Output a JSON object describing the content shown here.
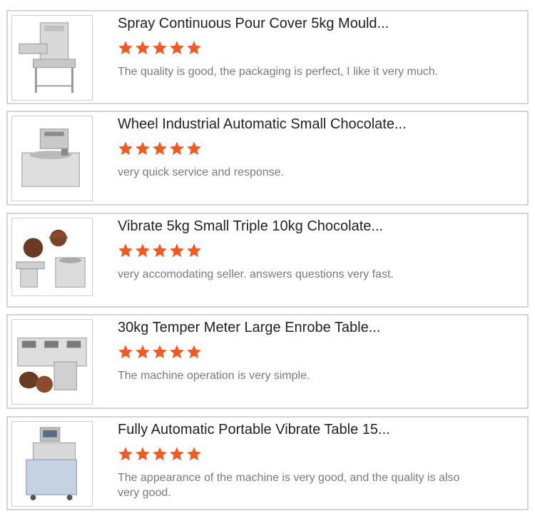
{
  "star_color": "#f15a22",
  "reviews": [
    {
      "title": "Spray Continuous Pour Cover 5kg Mould...",
      "rating": 5,
      "comment": "The quality is good, the packaging is perfect, I like it very much.",
      "image_icon": "chocolate-enrober-machine"
    },
    {
      "title": "Wheel Industrial Automatic Small Chocolate...",
      "rating": 5,
      "comment": "very quick service and response.",
      "image_icon": "chocolate-tempering-machine"
    },
    {
      "title": "Vibrate 5kg Small Triple 10kg Chocolate...",
      "rating": 5,
      "comment": "very accomodating seller. answers questions very fast.",
      "image_icon": "chocolate-melter-with-enrober"
    },
    {
      "title": "30kg Temper Meter Large Enrobe Table...",
      "rating": 5,
      "comment": "The machine operation is very simple.",
      "image_icon": "triple-tank-tempering-machine"
    },
    {
      "title": "Fully Automatic Portable Vibrate Table 15...",
      "rating": 5,
      "comment": "The appearance of the machine is very good, and the quality is also very good.",
      "image_icon": "vertical-tempering-machine"
    }
  ]
}
